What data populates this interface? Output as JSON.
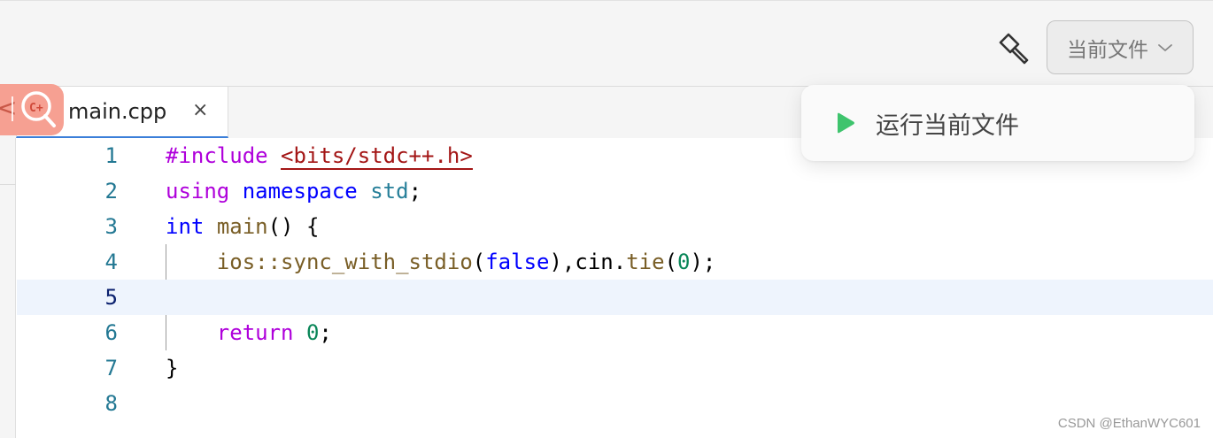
{
  "toolbar": {
    "build_icon": "hammer-icon",
    "run_config_label": "当前文件",
    "run_config_icon": "chevron-down-icon"
  },
  "tabs": [
    {
      "label": "main.cpp",
      "close_glyph": "×",
      "icon": "cpp-file-icon"
    }
  ],
  "overlay": {
    "back_glyph": "<",
    "badge": "C+",
    "search_icon": "search-icon"
  },
  "editor": {
    "current_line": 5,
    "line_numbers": [
      "1",
      "2",
      "3",
      "4",
      "5",
      "6",
      "7",
      "8"
    ],
    "lines": [
      [
        "#include ",
        "<bits/stdc++.h>"
      ],
      [
        "using",
        " ",
        "namespace",
        " ",
        "std",
        ";"
      ],
      [
        "int",
        " ",
        "main",
        "() {"
      ],
      [
        "    ",
        "ios::sync_with_stdio",
        "(",
        "false",
        "),",
        "cin",
        ".",
        "tie",
        "(",
        "0",
        ");"
      ],
      [
        ""
      ],
      [
        "    ",
        "return",
        " ",
        "0",
        ";"
      ],
      [
        "}"
      ],
      [
        ""
      ]
    ]
  },
  "dropdown": {
    "item_label": "运行当前文件",
    "item_icon": "play-icon",
    "play_color": "#3ec46d"
  },
  "watermark": "CSDN @EthanWYC601"
}
